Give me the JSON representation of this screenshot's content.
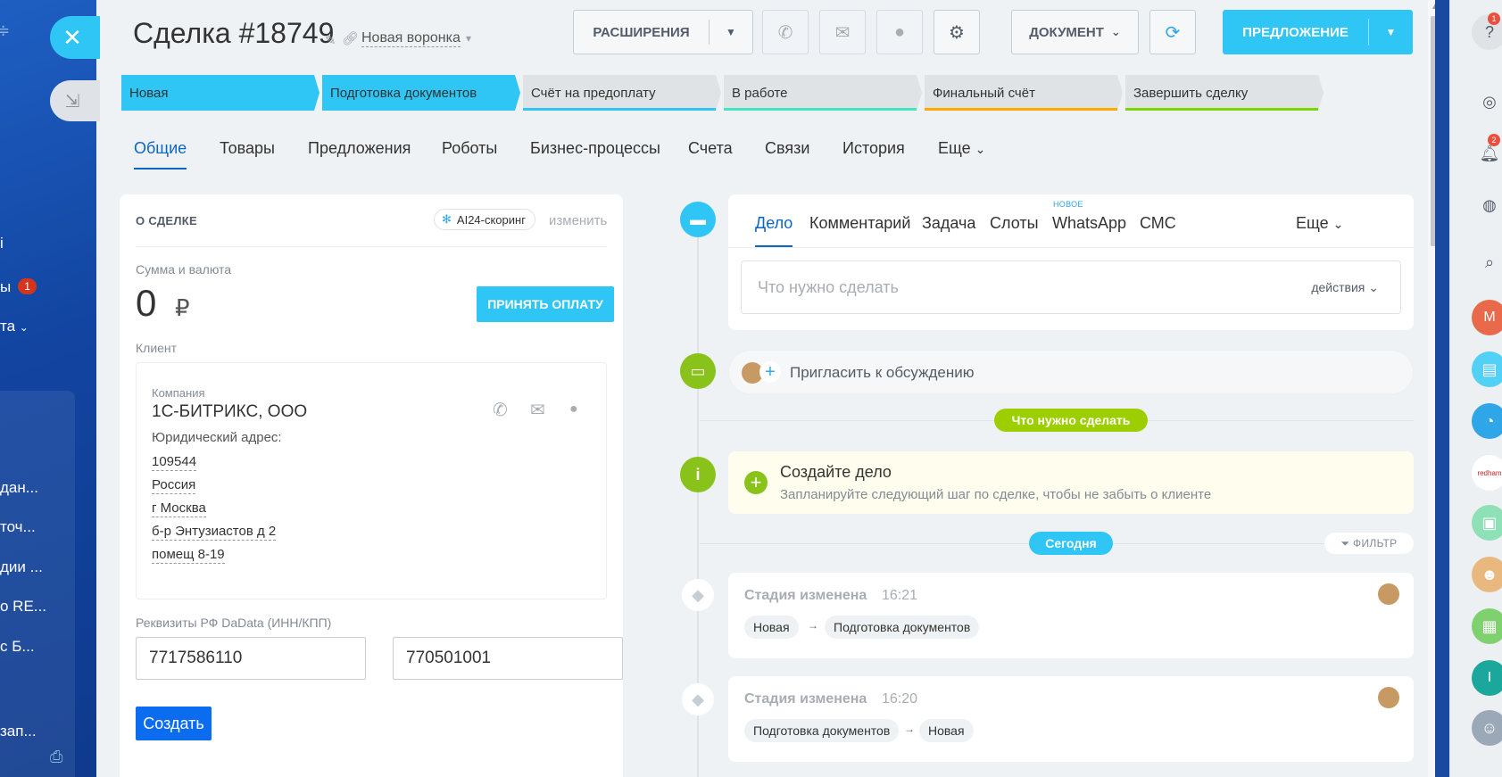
{
  "backdrop": {
    "items": [
      {
        "text": "ы",
        "top": 0
      },
      {
        "text": "та",
        "top": 0
      }
    ],
    "badge": "1",
    "list": [
      "дан...",
      "точ...",
      "дии ...",
      "о RE...",
      "с Б...",
      "зап..."
    ]
  },
  "header": {
    "title": "Сделка #18749",
    "funnel": "Новая воронка",
    "extensions_label": "РАСШИРЕНИЯ",
    "document_label": "ДОКУМЕНТ",
    "offer_label": "ПРЕДЛОЖЕНИЕ"
  },
  "stages": [
    {
      "label": "Новая",
      "state": "active",
      "color": "#2fc6f6"
    },
    {
      "label": "Подготовка документов",
      "state": "active",
      "color": "#2fc6f6"
    },
    {
      "label": "Счёт на предоплату",
      "state": "inactive",
      "color": "#2fc6f6"
    },
    {
      "label": "В работе",
      "state": "inactive",
      "color": "#47e4c2"
    },
    {
      "label": "Финальный счёт",
      "state": "inactive",
      "color": "#ffa900"
    },
    {
      "label": "Завершить сделку",
      "state": "inactive",
      "color": "#7bd500"
    }
  ],
  "tabs": [
    "Общие",
    "Товары",
    "Предложения",
    "Роботы",
    "Бизнес-процессы",
    "Счета",
    "Связи",
    "История",
    "Еще"
  ],
  "about": {
    "title": "О СДЕЛКЕ",
    "ai_chip": "AI24-скоринг",
    "edit": "изменить",
    "sum_label": "Сумма и валюта",
    "sum_value": "0",
    "currency": "₽",
    "pay_button": "ПРИНЯТЬ ОПЛАТУ",
    "client_label": "Клиент",
    "company_label": "Компания",
    "company_name": "1С-БИТРИКС, ООО",
    "address_label": "Юридический адрес:",
    "address_lines": [
      "109544",
      "Россия",
      "г Москва",
      "б-р Энтузиастов д 2",
      "помещ 8-19"
    ],
    "requisites_label": "Реквизиты РФ DaData (ИНН/КПП)",
    "inn": "7717586110",
    "kpp": "770501001",
    "create_button": "Создать"
  },
  "activity": {
    "tabs": [
      "Дело",
      "Комментарий",
      "Задача",
      "Слоты",
      "WhatsApp",
      "СМС",
      "Еще"
    ],
    "new_badge": "НОВОЕ",
    "placeholder": "Что нужно сделать",
    "actions": "действия"
  },
  "timeline": {
    "invite": "Пригласить к обсуждению",
    "todo_pill": "Что нужно сделать",
    "create_title": "Создайте дело",
    "create_sub": "Запланируйте следующий шаг по сделке, чтобы не забыть о клиенте",
    "today_pill": "Сегодня",
    "filter": "ФИЛЬТР",
    "history": [
      {
        "title": "Стадия изменена",
        "time": "16:21",
        "from": "Новая",
        "to": "Подготовка документов"
      },
      {
        "title": "Стадия изменена",
        "time": "16:20",
        "from": "Подготовка документов",
        "to": "Новая"
      }
    ]
  },
  "rightbar": {
    "help_badge": "1",
    "notify_badge": "2",
    "avatar_m": "М",
    "avatar_i": "I",
    "redham": "redham"
  }
}
